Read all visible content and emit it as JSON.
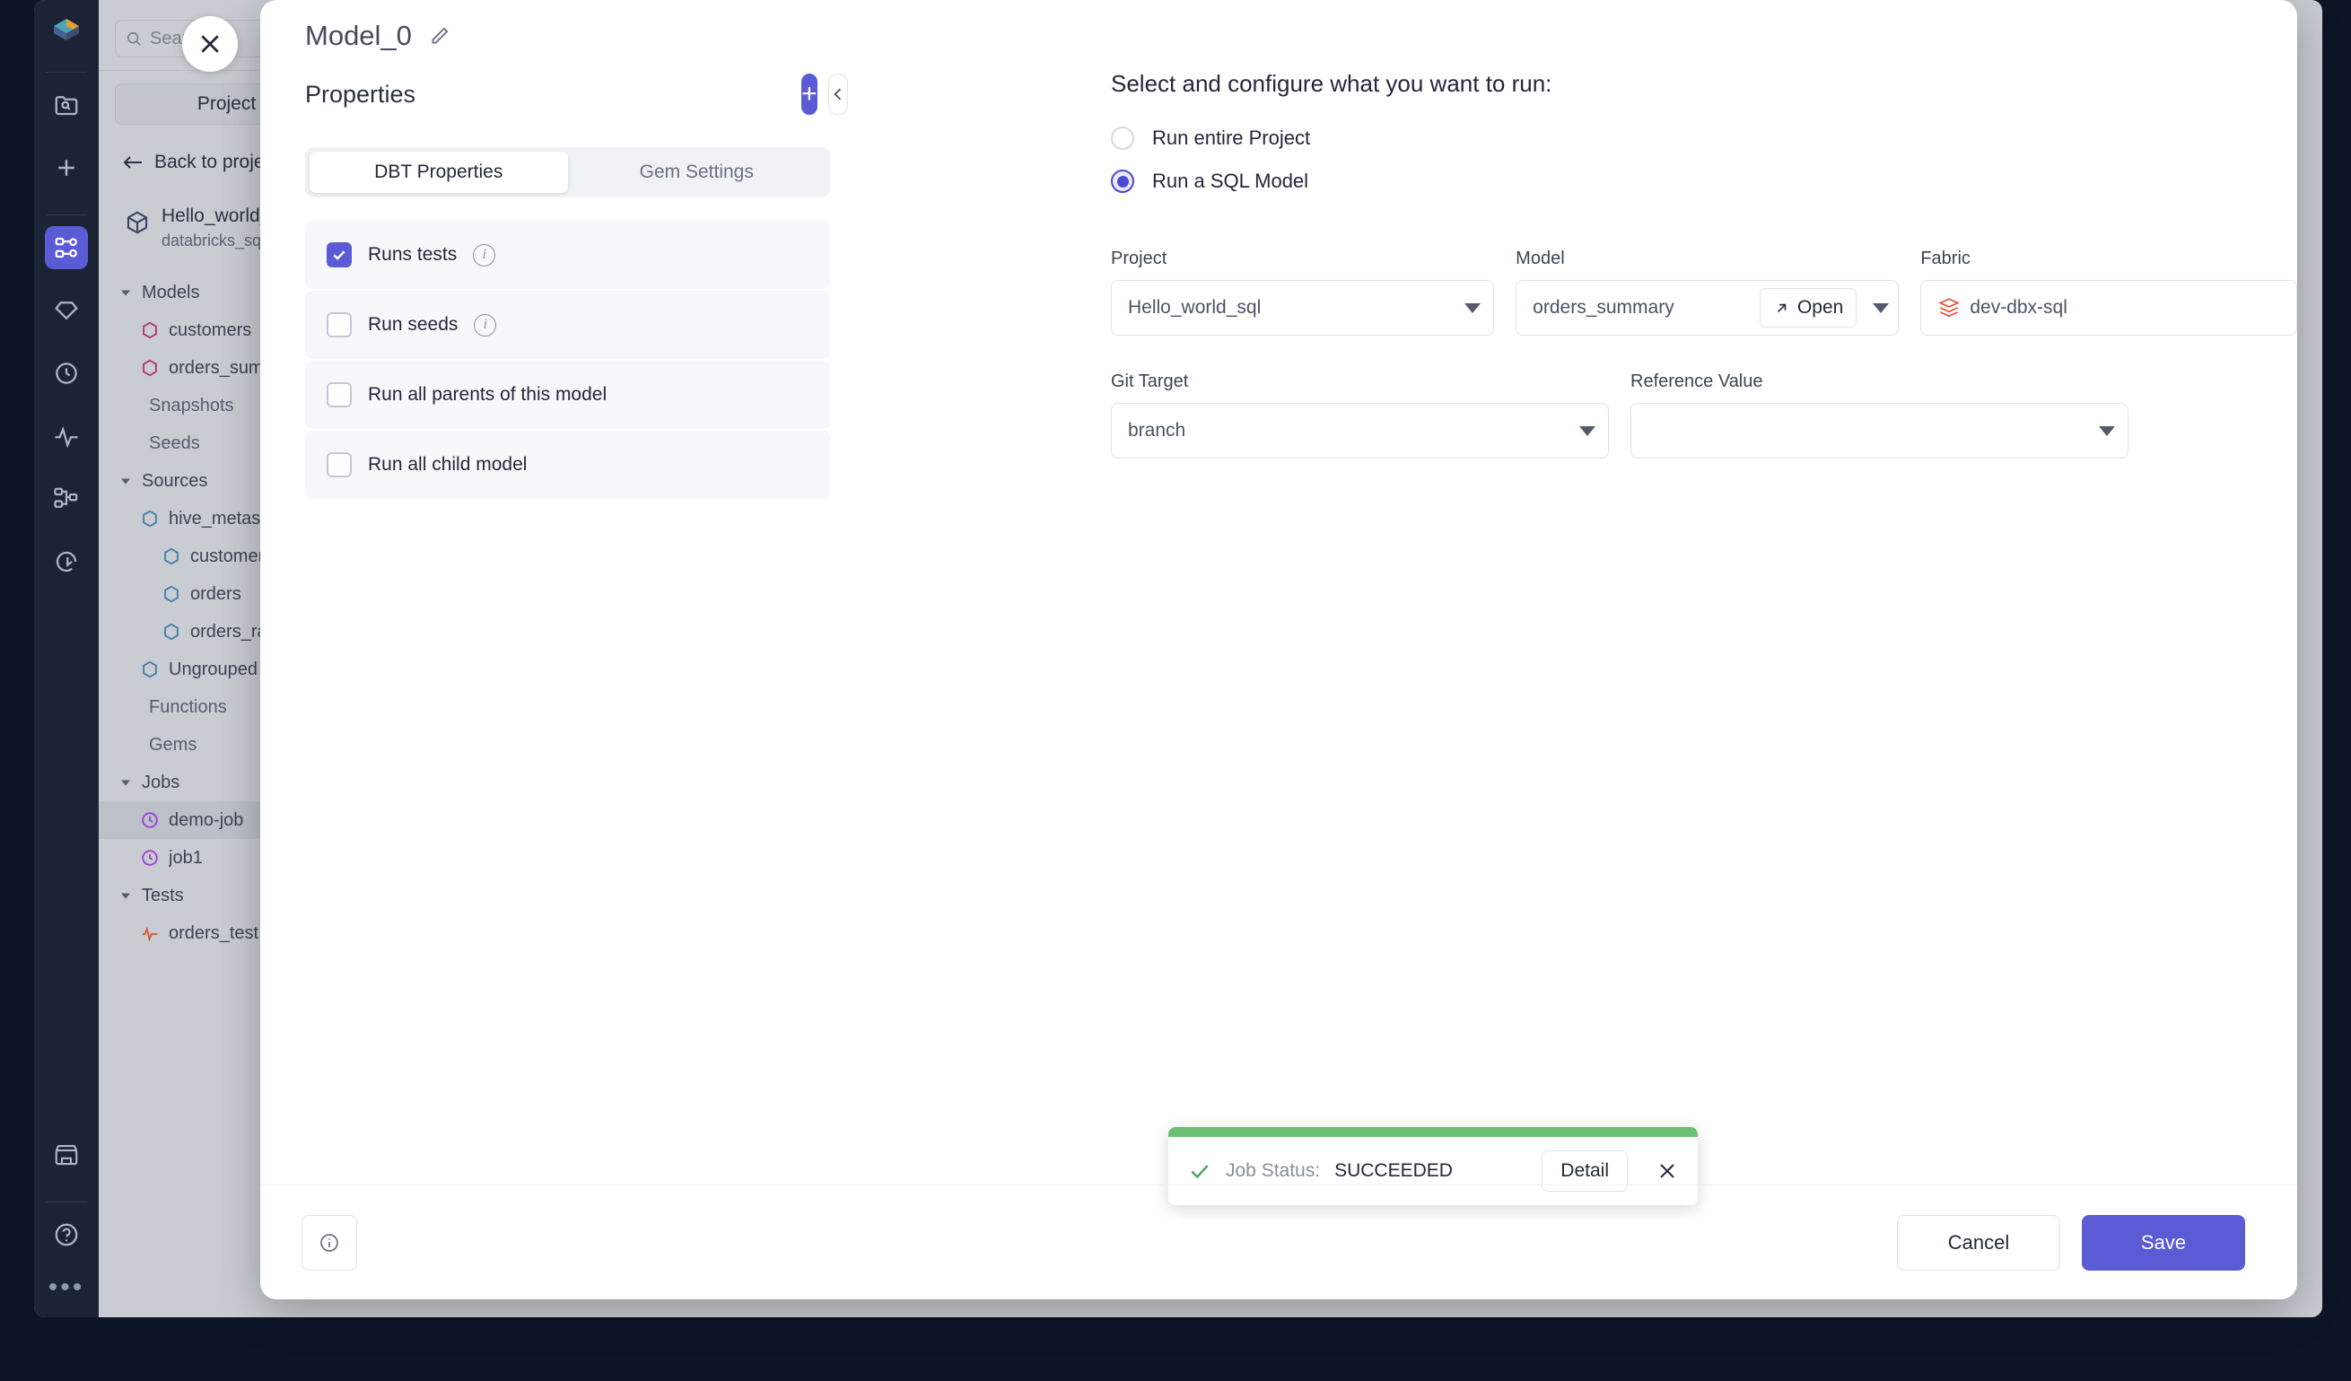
{
  "colors": {
    "accent": "#5b5bd6",
    "rail_bg": "#1b2335",
    "panel_bg": "#c9ccd2",
    "success": "#6cbf73",
    "model_hex": "#b5336a",
    "source_hex": "#3f7fa8",
    "job_clock": "#9b3fd4",
    "test_pulse": "#d4582f",
    "fabric_icon": "#e8553a"
  },
  "rail": {
    "logo": "prophecy-logo-icon",
    "items": [
      {
        "name": "project-search-icon",
        "active": false
      },
      {
        "name": "add-icon",
        "active": false
      },
      {
        "name": "pipeline-graph-icon",
        "active": true
      },
      {
        "name": "gem-diamond-icon",
        "active": false
      },
      {
        "name": "history-clock-icon",
        "active": false
      },
      {
        "name": "monitoring-pulse-icon",
        "active": false
      },
      {
        "name": "lineage-icon",
        "active": false
      },
      {
        "name": "deploy-download-icon",
        "active": false
      }
    ],
    "bottom": [
      {
        "name": "marketplace-icon"
      },
      {
        "name": "help-icon"
      },
      {
        "name": "more-options-icon"
      }
    ]
  },
  "project_panel": {
    "search_placeholder": "Search",
    "project_button": "Project",
    "back_link": "Back to project",
    "project_name": "Hello_world_sql",
    "project_sub": "databricks_sql",
    "tree": [
      {
        "label": "Models",
        "type": "group",
        "indent": 0,
        "expanded": true,
        "icon": "caret-down-icon"
      },
      {
        "label": "customers",
        "type": "model",
        "indent": 1,
        "icon": "model-hex-icon"
      },
      {
        "label": "orders_summary",
        "type": "model",
        "indent": 1,
        "icon": "model-hex-icon"
      },
      {
        "label": "Snapshots",
        "type": "plain",
        "indent": 0
      },
      {
        "label": "Seeds",
        "type": "plain",
        "indent": 0
      },
      {
        "label": "Sources",
        "type": "group",
        "indent": 0,
        "expanded": true,
        "icon": "caret-down-icon"
      },
      {
        "label": "hive_metastore",
        "type": "source",
        "indent": 1,
        "icon": "source-hex-icon"
      },
      {
        "label": "customers",
        "type": "source",
        "indent": 2,
        "icon": "source-hex-icon"
      },
      {
        "label": "orders",
        "type": "source",
        "indent": 2,
        "icon": "source-hex-icon"
      },
      {
        "label": "orders_raw",
        "type": "source",
        "indent": 2,
        "icon": "source-hex-icon"
      },
      {
        "label": "Ungrouped",
        "type": "source",
        "indent": 1,
        "icon": "source-hex-icon"
      },
      {
        "label": "Functions",
        "type": "plain",
        "indent": 0
      },
      {
        "label": "Gems",
        "type": "plain",
        "indent": 0
      },
      {
        "label": "Jobs",
        "type": "group",
        "indent": 0,
        "expanded": true,
        "icon": "caret-down-icon"
      },
      {
        "label": "demo-job",
        "type": "job",
        "indent": 1,
        "icon": "job-clock-icon",
        "selected": true
      },
      {
        "label": "job1",
        "type": "job",
        "indent": 1,
        "icon": "job-clock-icon"
      },
      {
        "label": "Tests",
        "type": "group",
        "indent": 0,
        "expanded": true,
        "icon": "caret-down-icon"
      },
      {
        "label": "orders_test",
        "type": "test",
        "indent": 1,
        "icon": "test-pulse-icon"
      }
    ]
  },
  "modal": {
    "close_icon": "close-icon",
    "title": "Model_0",
    "edit_icon": "pencil-edit-icon",
    "properties_label": "Properties",
    "add_button_label": "+",
    "collapse_button_icon": "chevron-left-icon",
    "tabs": [
      {
        "label": "DBT Properties",
        "active": true
      },
      {
        "label": "Gem Settings",
        "active": false
      }
    ],
    "checkboxes": [
      {
        "label": "Runs tests",
        "checked": true,
        "info": true
      },
      {
        "label": "Run seeds",
        "checked": false,
        "info": true
      },
      {
        "label": "Run all parents of this model",
        "checked": false,
        "info": false
      },
      {
        "label": "Run all child model",
        "checked": false,
        "info": false
      }
    ],
    "run_config": {
      "heading": "Select and configure what you want to run:",
      "options": [
        {
          "label": "Run entire Project",
          "selected": false
        },
        {
          "label": "Run a SQL Model",
          "selected": true
        }
      ],
      "fields": {
        "project": {
          "label": "Project",
          "value": "Hello_world_sql"
        },
        "model": {
          "label": "Model",
          "value": "orders_summary",
          "open_label": "Open",
          "open_icon": "external-link-icon"
        },
        "fabric": {
          "label": "Fabric",
          "value": "dev-dbx-sql",
          "icon": "databricks-layers-icon"
        },
        "git_target": {
          "label": "Git Target",
          "value": "branch"
        },
        "reference": {
          "label": "Reference Value",
          "value": ""
        }
      }
    },
    "toast": {
      "status_icon": "check-icon",
      "label": "Job Status:",
      "value": "SUCCEEDED",
      "detail_button": "Detail",
      "close_icon": "close-icon"
    },
    "footer": {
      "info_icon": "info-circle-icon",
      "cancel_label": "Cancel",
      "save_label": "Save"
    }
  }
}
